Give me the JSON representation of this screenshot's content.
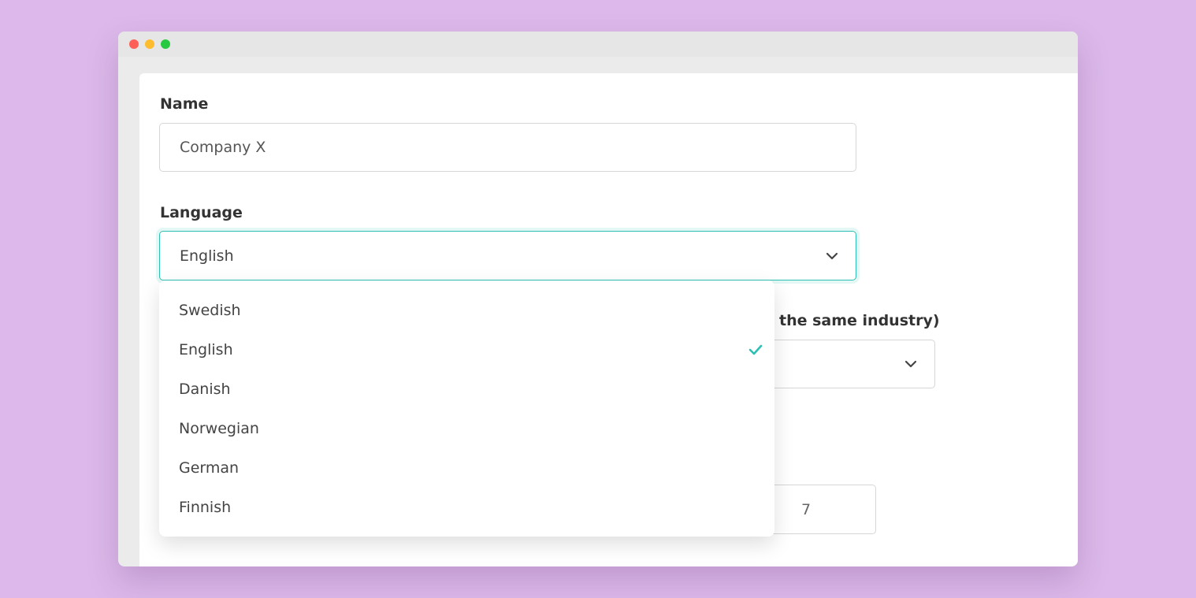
{
  "form": {
    "name_label": "Name",
    "name_value": "Company X",
    "language_label": "Language",
    "language_value": "English",
    "industry_label_partial": "the same industry)",
    "number_value": "7"
  },
  "language_dropdown": {
    "selected": "English",
    "options": [
      {
        "label": "Swedish",
        "selected": false
      },
      {
        "label": "English",
        "selected": true
      },
      {
        "label": "Danish",
        "selected": false
      },
      {
        "label": "Norwegian",
        "selected": false
      },
      {
        "label": "German",
        "selected": false
      },
      {
        "label": "Finnish",
        "selected": false
      }
    ]
  },
  "colors": {
    "background": "#dcb9ea",
    "accent": "#2dbfb3",
    "window_chrome": "#e6e6e6"
  },
  "icons": {
    "dropdown": "chevron-down-icon",
    "selected": "check-icon"
  }
}
